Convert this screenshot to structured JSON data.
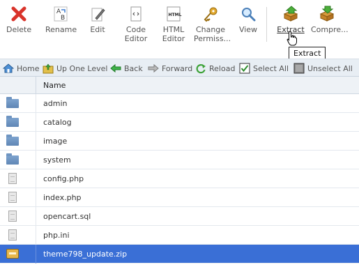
{
  "toolbar": {
    "buttons": [
      {
        "id": "delete",
        "label": "Delete"
      },
      {
        "id": "rename",
        "label": "Rename"
      },
      {
        "id": "edit",
        "label": "Edit"
      },
      {
        "id": "code_editor",
        "label": "Code\nEditor"
      },
      {
        "id": "html_editor",
        "label": "HTML\nEditor"
      },
      {
        "id": "change_permissions",
        "label": "Change\nPermiss..."
      },
      {
        "id": "view",
        "label": "View"
      },
      {
        "id": "extract",
        "label": "Extract"
      },
      {
        "id": "compress",
        "label": "Compre..."
      }
    ],
    "html_icon_text": "HTML",
    "tooltip": "Extract"
  },
  "nav": {
    "home": "Home",
    "up": "Up One Level",
    "back": "Back",
    "forward": "Forward",
    "reload": "Reload",
    "select_all": "Select All",
    "unselect_all": "Unselect All"
  },
  "table": {
    "name_header": "Name",
    "rows": [
      {
        "name": "admin",
        "type": "folder"
      },
      {
        "name": "catalog",
        "type": "folder"
      },
      {
        "name": "image",
        "type": "folder"
      },
      {
        "name": "system",
        "type": "folder"
      },
      {
        "name": "config.php",
        "type": "file"
      },
      {
        "name": "index.php",
        "type": "file"
      },
      {
        "name": "opencart.sql",
        "type": "file"
      },
      {
        "name": "php.ini",
        "type": "file"
      },
      {
        "name": "theme798_update.zip",
        "type": "zip",
        "selected": true
      }
    ]
  },
  "colors": {
    "selection": "#3a6fd6",
    "navbar": "#e8eef4",
    "delete_red": "#d9332a"
  }
}
